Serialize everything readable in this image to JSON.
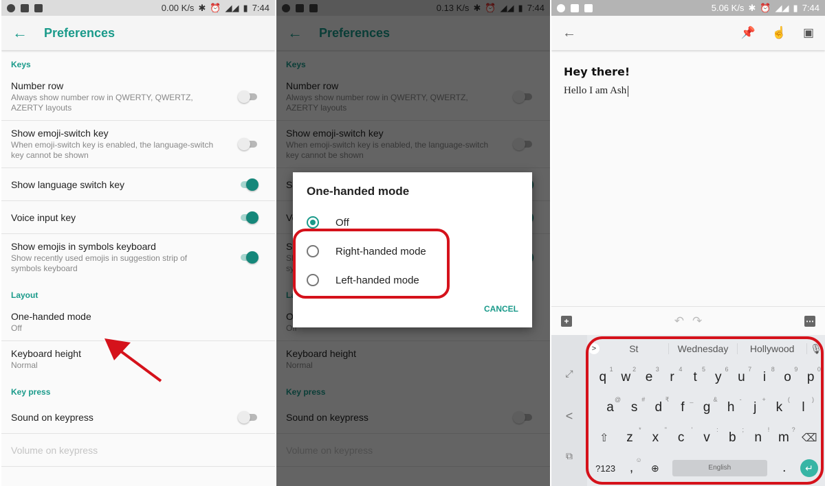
{
  "colors": {
    "accent": "#1a9a8a",
    "highlight": "#d5121b",
    "enter_key": "#37b5a5"
  },
  "panel1": {
    "status": {
      "speed": "0.00 K/s",
      "time": "7:44",
      "left_icons": [
        "navigation-icon",
        "image-icon",
        "activity-icon"
      ],
      "right_icons": [
        "bluetooth-icon",
        "alarm-icon",
        "signal-4g-icon",
        "signal-icon",
        "battery-icon"
      ]
    },
    "toolbar": {
      "back_icon": "←",
      "title": "Preferences"
    },
    "sections": [
      {
        "header": "Keys",
        "items": [
          {
            "title": "Number row",
            "summary": "Always show number row in QWERTY, QWERTZ, AZERTY layouts",
            "toggle": false
          },
          {
            "title": "Show emoji-switch key",
            "summary": "When emoji-switch key is enabled, the language-switch key cannot be shown",
            "toggle": false
          },
          {
            "title": "Show language switch key",
            "summary": "",
            "toggle": true
          },
          {
            "title": "Voice input key",
            "summary": "",
            "toggle": true
          },
          {
            "title": "Show emojis in symbols keyboard",
            "summary": "Show recently used emojis in suggestion strip of symbols keyboard",
            "toggle": true
          }
        ]
      },
      {
        "header": "Layout",
        "items": [
          {
            "title": "One-handed mode",
            "summary": "Off"
          },
          {
            "title": "Keyboard height",
            "summary": "Normal"
          }
        ]
      },
      {
        "header": "Key press",
        "items": [
          {
            "title": "Sound on keypress",
            "toggle": false
          },
          {
            "title": "Volume on keypress",
            "disabled": true
          }
        ]
      }
    ]
  },
  "panel2": {
    "status": {
      "speed": "0.13 K/s",
      "time": "7:44"
    },
    "dialog": {
      "title": "One-handed mode",
      "options": [
        {
          "label": "Off",
          "selected": true
        },
        {
          "label": "Right-handed mode",
          "selected": false
        },
        {
          "label": "Left-handed mode",
          "selected": false
        }
      ],
      "cancel": "CANCEL"
    }
  },
  "panel3": {
    "status": {
      "speed": "5.06 K/s",
      "time": "7:44"
    },
    "toolbar": {
      "back_icon": "←",
      "icons": [
        "pin-icon",
        "reminder-icon",
        "archive-icon"
      ]
    },
    "note": {
      "title": "Hey there!",
      "body": "Hello I am Ash"
    },
    "editbar": {
      "add": "+",
      "undo": "↶",
      "redo": "↷",
      "more": "⋯"
    },
    "keyboard": {
      "side": {
        "expand": "⤢",
        "collapse": "<",
        "popout": "⧉"
      },
      "suggestions": [
        "St",
        "Wednesday",
        "Hollywood"
      ],
      "suggest_chevron": ">",
      "mic": "🎤",
      "row1": [
        {
          "k": "q",
          "s": "1"
        },
        {
          "k": "w",
          "s": "2"
        },
        {
          "k": "e",
          "s": "3"
        },
        {
          "k": "r",
          "s": "4"
        },
        {
          "k": "t",
          "s": "5"
        },
        {
          "k": "y",
          "s": "6"
        },
        {
          "k": "u",
          "s": "7"
        },
        {
          "k": "i",
          "s": "8"
        },
        {
          "k": "o",
          "s": "9"
        },
        {
          "k": "p",
          "s": "0"
        }
      ],
      "row2": [
        {
          "k": "a",
          "s": "@"
        },
        {
          "k": "s",
          "s": "#"
        },
        {
          "k": "d",
          "s": "₹"
        },
        {
          "k": "f",
          "s": "_"
        },
        {
          "k": "g",
          "s": "&"
        },
        {
          "k": "h",
          "s": "-"
        },
        {
          "k": "j",
          "s": "+"
        },
        {
          "k": "k",
          "s": "("
        },
        {
          "k": "l",
          "s": ")"
        }
      ],
      "row3": [
        {
          "k": "z",
          "s": "*"
        },
        {
          "k": "x",
          "s": "\""
        },
        {
          "k": "c",
          "s": "'"
        },
        {
          "k": "v",
          "s": ":"
        },
        {
          "k": "b",
          "s": ";"
        },
        {
          "k": "n",
          "s": "!"
        },
        {
          "k": "m",
          "s": "?"
        }
      ],
      "shift": "⇧",
      "backspace": "⌫",
      "symbols": "?123",
      "comma": ",",
      "emoji_hint": "☺",
      "globe": "🌐",
      "space": "English",
      "period": ".",
      "enter": "↵"
    }
  }
}
